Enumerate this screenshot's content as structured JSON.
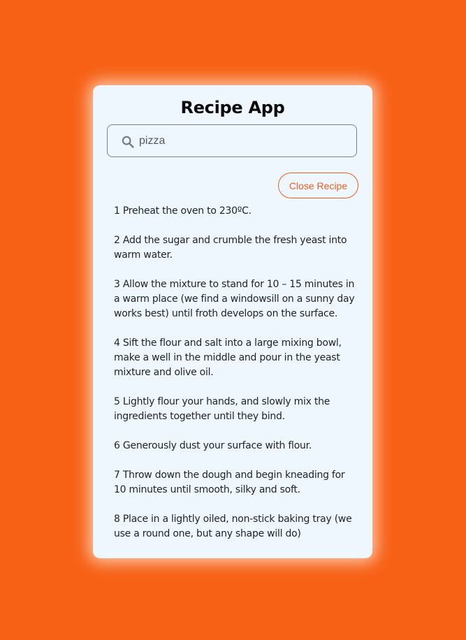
{
  "app": {
    "title": "Recipe App"
  },
  "search": {
    "value": "pizza",
    "icon": "search-icon"
  },
  "recipe": {
    "close_label": "Close Recipe",
    "steps": [
      "1 Preheat the oven to 230ºC.",
      "2 Add the sugar and crumble the fresh yeast into warm water.",
      "3 Allow the mixture to stand for 10 – 15 minutes in a warm place (we find a windowsill on a sunny day works best) until froth develops on the surface.",
      "4 Sift the flour and salt into a large mixing bowl, make a well in the middle and pour in the yeast mixture and olive oil.",
      "5 Lightly flour your hands, and slowly mix the ingredients together until they bind.",
      "6 Generously dust your surface with flour.",
      "7 Throw down the dough and begin kneading for 10 minutes until smooth, silky and soft.",
      "8 Place in a lightly oiled, non-stick baking tray (we use a round one, but any shape will do)"
    ]
  },
  "colors": {
    "background": "#f76116",
    "card": "#eef7fd",
    "accent": "#f05e1c"
  }
}
